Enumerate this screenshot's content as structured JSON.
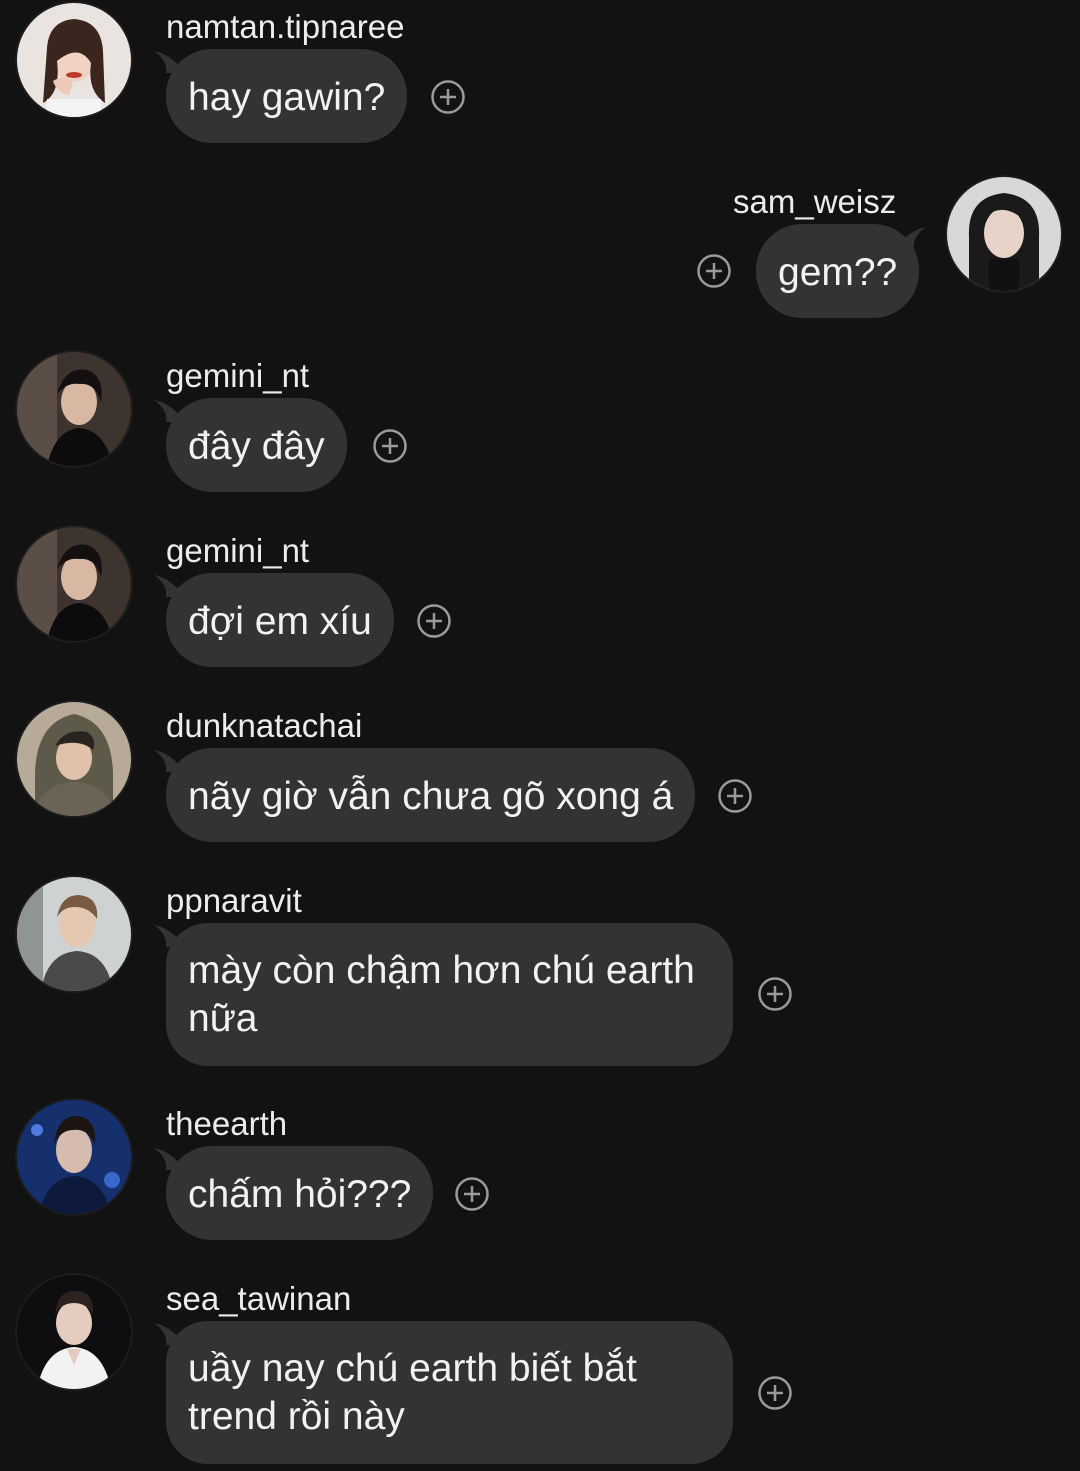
{
  "messages": [
    {
      "username": "namtan.tipnaree",
      "text": "hay gawin?",
      "side": "left",
      "avatar": "avatar-namtan"
    },
    {
      "username": "sam_weisz",
      "text": "gem??",
      "side": "right",
      "avatar": "avatar-sam"
    },
    {
      "username": "gemini_nt",
      "text": "đây đây",
      "side": "left",
      "avatar": "avatar-gemini"
    },
    {
      "username": "gemini_nt",
      "text": "đợi em xíu",
      "side": "left",
      "avatar": "avatar-gemini"
    },
    {
      "username": "dunknatachai",
      "text": "nãy giờ vẫn chưa gõ xong á",
      "side": "left",
      "avatar": "avatar-dunk"
    },
    {
      "username": "ppnaravit",
      "text_lines": [
        "mày còn chậm hơn chú earth",
        "nữa"
      ],
      "side": "left",
      "avatar": "avatar-pp"
    },
    {
      "username": "theearth",
      "text": "chấm hỏi???",
      "side": "left",
      "avatar": "avatar-earth"
    },
    {
      "username": "sea_tawinan",
      "text_lines": [
        "uầy nay chú earth biết bắt",
        "trend rồi này"
      ],
      "side": "left",
      "avatar": "avatar-sea"
    }
  ],
  "icons": {
    "react": "add-reaction-icon"
  },
  "colors": {
    "background": "#121212",
    "bubble": "#333333",
    "text": "#f2f2f2",
    "icon": "#9a9a9a"
  }
}
